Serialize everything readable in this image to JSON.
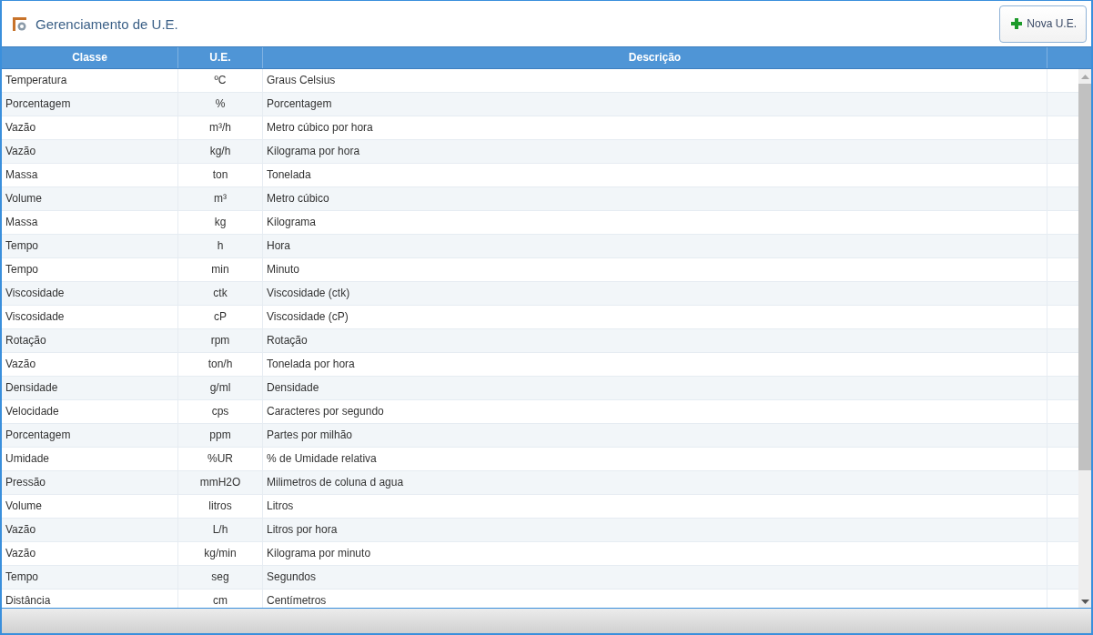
{
  "window": {
    "title": "Gerenciamento de U.E."
  },
  "toolbar": {
    "new_button": "Nova U.E."
  },
  "table": {
    "columns": [
      "Classe",
      "U.E.",
      "Descrição"
    ],
    "rows": [
      [
        "Temperatura",
        "ºC",
        "Graus Celsius"
      ],
      [
        "Porcentagem",
        "%",
        "Porcentagem"
      ],
      [
        "Vazão",
        "m³/h",
        "Metro cúbico por hora"
      ],
      [
        "Vazão",
        "kg/h",
        "Kilograma por hora"
      ],
      [
        "Massa",
        "ton",
        "Tonelada"
      ],
      [
        "Volume",
        "m³",
        "Metro cúbico"
      ],
      [
        "Massa",
        "kg",
        "Kilograma"
      ],
      [
        "Tempo",
        "h",
        "Hora"
      ],
      [
        "Tempo",
        "min",
        "Minuto"
      ],
      [
        "Viscosidade",
        "ctk",
        "Viscosidade (ctk)"
      ],
      [
        "Viscosidade",
        "cP",
        "Viscosidade (cP)"
      ],
      [
        "Rotação",
        "rpm",
        "Rotação"
      ],
      [
        "Vazão",
        "ton/h",
        "Tonelada por hora"
      ],
      [
        "Densidade",
        "g/ml",
        "Densidade"
      ],
      [
        "Velocidade",
        "cps",
        "Caracteres por segundo"
      ],
      [
        "Porcentagem",
        "ppm",
        "Partes por milhão"
      ],
      [
        "Umidade",
        "%UR",
        "% de Umidade relativa"
      ],
      [
        "Pressão",
        "mmH2O",
        "Milimetros de coluna d agua"
      ],
      [
        "Volume",
        "litros",
        "Litros"
      ],
      [
        "Vazão",
        "L/h",
        "Litros por hora"
      ],
      [
        "Vazão",
        "kg/min",
        "Kilograma por minuto"
      ],
      [
        "Tempo",
        "seg",
        "Segundos"
      ],
      [
        "Distância",
        "cm",
        "Centímetros"
      ]
    ]
  }
}
